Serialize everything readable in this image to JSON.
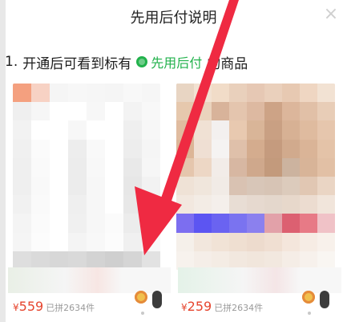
{
  "modal": {
    "title": "先用后付说明"
  },
  "steps": [
    {
      "number": "1.",
      "text_before": "开通后可看到标有",
      "badge": "先用后付",
      "text_after": "的商品"
    }
  ],
  "products": [
    {
      "price_currency": "¥",
      "price": "559",
      "sold": "已拼2634件"
    },
    {
      "price_currency": "¥",
      "price": "259",
      "sold": "已拼2634件"
    }
  ],
  "colors": {
    "accent_green": "#22b24c",
    "price_red": "#e6452e",
    "arrow_red": "#ef2a42"
  }
}
